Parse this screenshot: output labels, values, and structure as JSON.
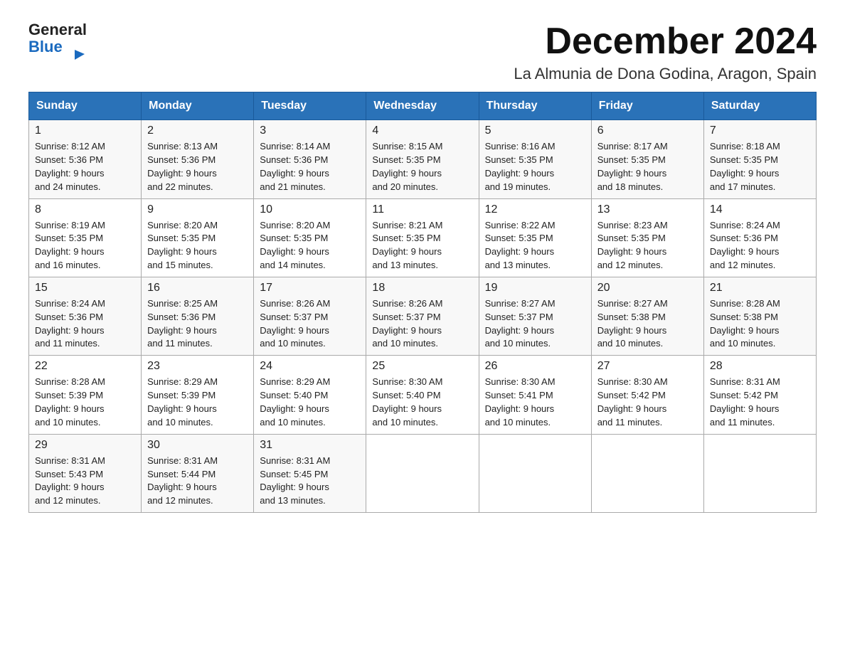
{
  "logo": {
    "general": "General",
    "blue": "Blue",
    "arrow": "▶"
  },
  "title": "December 2024",
  "location": "La Almunia de Dona Godina, Aragon, Spain",
  "weekdays": [
    "Sunday",
    "Monday",
    "Tuesday",
    "Wednesday",
    "Thursday",
    "Friday",
    "Saturday"
  ],
  "weeks": [
    [
      {
        "day": "1",
        "sunrise": "8:12 AM",
        "sunset": "5:36 PM",
        "daylight": "9 hours and 24 minutes."
      },
      {
        "day": "2",
        "sunrise": "8:13 AM",
        "sunset": "5:36 PM",
        "daylight": "9 hours and 22 minutes."
      },
      {
        "day": "3",
        "sunrise": "8:14 AM",
        "sunset": "5:36 PM",
        "daylight": "9 hours and 21 minutes."
      },
      {
        "day": "4",
        "sunrise": "8:15 AM",
        "sunset": "5:35 PM",
        "daylight": "9 hours and 20 minutes."
      },
      {
        "day": "5",
        "sunrise": "8:16 AM",
        "sunset": "5:35 PM",
        "daylight": "9 hours and 19 minutes."
      },
      {
        "day": "6",
        "sunrise": "8:17 AM",
        "sunset": "5:35 PM",
        "daylight": "9 hours and 18 minutes."
      },
      {
        "day": "7",
        "sunrise": "8:18 AM",
        "sunset": "5:35 PM",
        "daylight": "9 hours and 17 minutes."
      }
    ],
    [
      {
        "day": "8",
        "sunrise": "8:19 AM",
        "sunset": "5:35 PM",
        "daylight": "9 hours and 16 minutes."
      },
      {
        "day": "9",
        "sunrise": "8:20 AM",
        "sunset": "5:35 PM",
        "daylight": "9 hours and 15 minutes."
      },
      {
        "day": "10",
        "sunrise": "8:20 AM",
        "sunset": "5:35 PM",
        "daylight": "9 hours and 14 minutes."
      },
      {
        "day": "11",
        "sunrise": "8:21 AM",
        "sunset": "5:35 PM",
        "daylight": "9 hours and 13 minutes."
      },
      {
        "day": "12",
        "sunrise": "8:22 AM",
        "sunset": "5:35 PM",
        "daylight": "9 hours and 13 minutes."
      },
      {
        "day": "13",
        "sunrise": "8:23 AM",
        "sunset": "5:35 PM",
        "daylight": "9 hours and 12 minutes."
      },
      {
        "day": "14",
        "sunrise": "8:24 AM",
        "sunset": "5:36 PM",
        "daylight": "9 hours and 12 minutes."
      }
    ],
    [
      {
        "day": "15",
        "sunrise": "8:24 AM",
        "sunset": "5:36 PM",
        "daylight": "9 hours and 11 minutes."
      },
      {
        "day": "16",
        "sunrise": "8:25 AM",
        "sunset": "5:36 PM",
        "daylight": "9 hours and 11 minutes."
      },
      {
        "day": "17",
        "sunrise": "8:26 AM",
        "sunset": "5:37 PM",
        "daylight": "9 hours and 10 minutes."
      },
      {
        "day": "18",
        "sunrise": "8:26 AM",
        "sunset": "5:37 PM",
        "daylight": "9 hours and 10 minutes."
      },
      {
        "day": "19",
        "sunrise": "8:27 AM",
        "sunset": "5:37 PM",
        "daylight": "9 hours and 10 minutes."
      },
      {
        "day": "20",
        "sunrise": "8:27 AM",
        "sunset": "5:38 PM",
        "daylight": "9 hours and 10 minutes."
      },
      {
        "day": "21",
        "sunrise": "8:28 AM",
        "sunset": "5:38 PM",
        "daylight": "9 hours and 10 minutes."
      }
    ],
    [
      {
        "day": "22",
        "sunrise": "8:28 AM",
        "sunset": "5:39 PM",
        "daylight": "9 hours and 10 minutes."
      },
      {
        "day": "23",
        "sunrise": "8:29 AM",
        "sunset": "5:39 PM",
        "daylight": "9 hours and 10 minutes."
      },
      {
        "day": "24",
        "sunrise": "8:29 AM",
        "sunset": "5:40 PM",
        "daylight": "9 hours and 10 minutes."
      },
      {
        "day": "25",
        "sunrise": "8:30 AM",
        "sunset": "5:40 PM",
        "daylight": "9 hours and 10 minutes."
      },
      {
        "day": "26",
        "sunrise": "8:30 AM",
        "sunset": "5:41 PM",
        "daylight": "9 hours and 10 minutes."
      },
      {
        "day": "27",
        "sunrise": "8:30 AM",
        "sunset": "5:42 PM",
        "daylight": "9 hours and 11 minutes."
      },
      {
        "day": "28",
        "sunrise": "8:31 AM",
        "sunset": "5:42 PM",
        "daylight": "9 hours and 11 minutes."
      }
    ],
    [
      {
        "day": "29",
        "sunrise": "8:31 AM",
        "sunset": "5:43 PM",
        "daylight": "9 hours and 12 minutes."
      },
      {
        "day": "30",
        "sunrise": "8:31 AM",
        "sunset": "5:44 PM",
        "daylight": "9 hours and 12 minutes."
      },
      {
        "day": "31",
        "sunrise": "8:31 AM",
        "sunset": "5:45 PM",
        "daylight": "9 hours and 13 minutes."
      },
      null,
      null,
      null,
      null
    ]
  ],
  "labels": {
    "sunrise": "Sunrise:",
    "sunset": "Sunset:",
    "daylight": "Daylight:"
  }
}
